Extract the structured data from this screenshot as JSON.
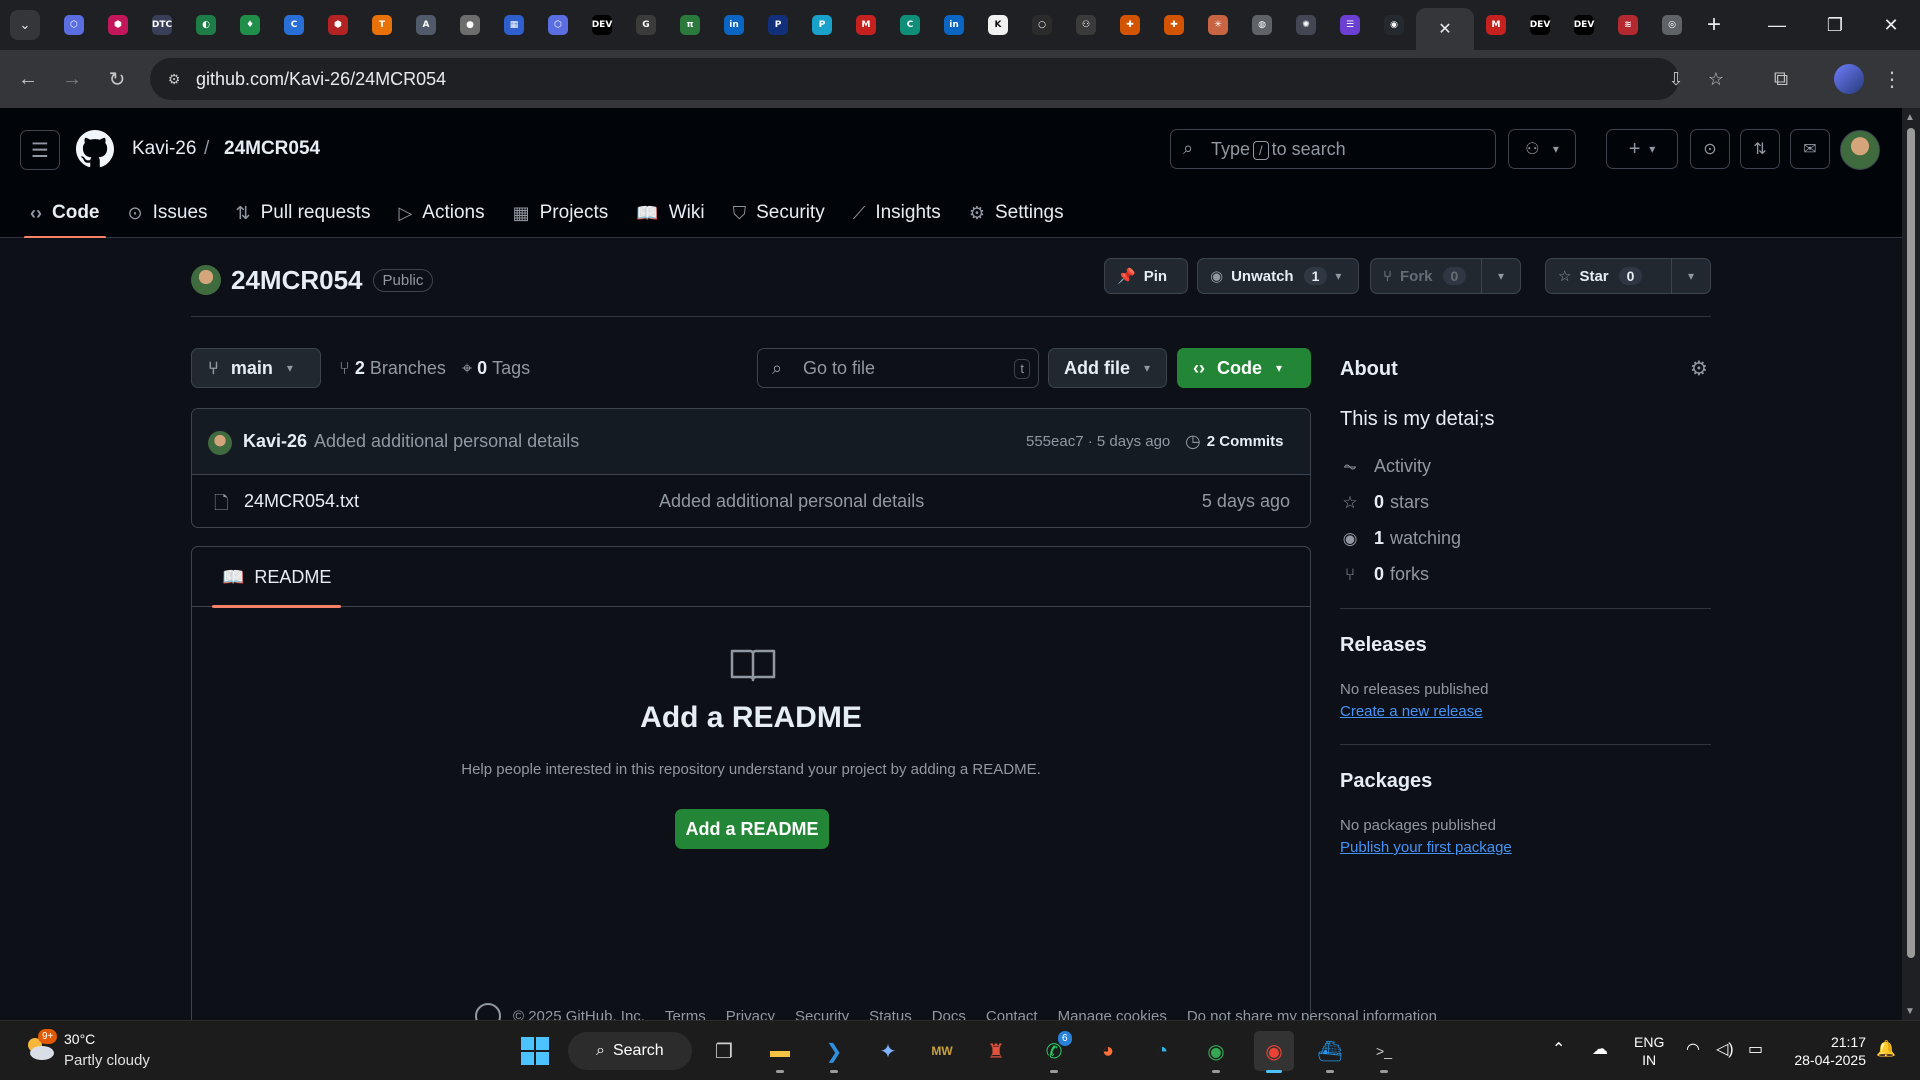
{
  "browser": {
    "tab_favicons": [
      {
        "name": "hexagon-tab-icon",
        "color": "#5b6ee1",
        "glyph": "⬡"
      },
      {
        "name": "shield-tab-icon",
        "color": "#c2185b",
        "glyph": "⬢"
      },
      {
        "name": "dtc-tab-icon",
        "color": "#3a3f58",
        "glyph": "DTC"
      },
      {
        "name": "green-circle-tab-icon",
        "color": "#1e7d46",
        "glyph": "◐"
      },
      {
        "name": "leaf-tab-icon",
        "color": "#1f8f4a",
        "glyph": "♦"
      },
      {
        "name": "c-tab-icon",
        "color": "#2a6fd6",
        "glyph": "C"
      },
      {
        "name": "red-badge-tab-icon",
        "color": "#b42323",
        "glyph": "⬢"
      },
      {
        "name": "tensorflow-tab-icon",
        "color": "#e8710a",
        "glyph": "T"
      },
      {
        "name": "a-tab-icon",
        "color": "#505a6b",
        "glyph": "A"
      },
      {
        "name": "profile-tab-icon",
        "color": "#6d6d6d",
        "glyph": "●"
      },
      {
        "name": "puzzle-tab-icon",
        "color": "#2f5fcc",
        "glyph": "▦"
      },
      {
        "name": "cube-tab-icon",
        "color": "#5b6ee1",
        "glyph": "⬡"
      },
      {
        "name": "dev-tab-icon",
        "color": "#000000",
        "glyph": "DEV"
      },
      {
        "name": "g-tab-icon",
        "color": "#3b3b3b",
        "glyph": "G"
      },
      {
        "name": "pi-tab-icon",
        "color": "#2b7a3b",
        "glyph": "π"
      },
      {
        "name": "linkedin-tab-icon",
        "color": "#0a66c2",
        "glyph": "in"
      },
      {
        "name": "paypal-tab-icon",
        "color": "#12307a",
        "glyph": "P"
      },
      {
        "name": "p-tab-icon",
        "color": "#1aa1c9",
        "glyph": "P"
      },
      {
        "name": "gmail-tab-icon",
        "color": "#c5221f",
        "glyph": "M"
      },
      {
        "name": "codechef-tab-icon",
        "color": "#0f8f7a",
        "glyph": "C"
      },
      {
        "name": "linkedin2-tab-icon",
        "color": "#0a66c2",
        "glyph": "in"
      },
      {
        "name": "k-tab-icon",
        "color": "#f1f1f1",
        "glyph": "K"
      },
      {
        "name": "github-dim-tab-icon",
        "color": "#2b2b2b",
        "glyph": "○"
      },
      {
        "name": "copilot-tab-icon",
        "color": "#3a3a3a",
        "glyph": "⚇"
      },
      {
        "name": "orange-tab-icon",
        "color": "#d35400",
        "glyph": "✚"
      },
      {
        "name": "orange2-tab-icon",
        "color": "#d35400",
        "glyph": "✚"
      },
      {
        "name": "claude-tab-icon",
        "color": "#c96442",
        "glyph": "✳"
      },
      {
        "name": "globe-tab-icon",
        "color": "#5f6368",
        "glyph": "◍"
      },
      {
        "name": "chatgpt-tab-icon",
        "color": "#444654",
        "glyph": "✺"
      },
      {
        "name": "purple-tab-icon",
        "color": "#6b3fd1",
        "glyph": "☰"
      },
      {
        "name": "github-tab-icon",
        "color": "#24292f",
        "glyph": "◉"
      }
    ],
    "tab_favicons_after": [
      {
        "name": "gmail2-tab-icon",
        "color": "#c5221f",
        "glyph": "M"
      },
      {
        "name": "dev2-tab-icon",
        "color": "#000000",
        "glyph": "DEV"
      },
      {
        "name": "dev3-tab-icon",
        "color": "#000000",
        "glyph": "DEV"
      },
      {
        "name": "stack-tab-icon",
        "color": "#b4282f",
        "glyph": "≋"
      },
      {
        "name": "chrome-tab-icon",
        "color": "#5f6368",
        "glyph": "◎"
      }
    ],
    "url": "github.com/Kavi-26/24MCR054"
  },
  "header": {
    "owner": "Kavi-26",
    "separator": "/",
    "repo": "24MCR054",
    "search_prefix": "Type",
    "search_key": "/",
    "search_suffix": "to search"
  },
  "repo_nav": [
    {
      "label": "Code",
      "icon": "‹›",
      "name": "tab-code"
    },
    {
      "label": "Issues",
      "icon": "⊙",
      "name": "tab-issues"
    },
    {
      "label": "Pull requests",
      "icon": "⇅",
      "name": "tab-pull-requests"
    },
    {
      "label": "Actions",
      "icon": "▷",
      "name": "tab-actions"
    },
    {
      "label": "Projects",
      "icon": "▦",
      "name": "tab-projects"
    },
    {
      "label": "Wiki",
      "icon": "📖",
      "name": "tab-wiki"
    },
    {
      "label": "Security",
      "icon": "⛉",
      "name": "tab-security"
    },
    {
      "label": "Insights",
      "icon": "⟋",
      "name": "tab-insights"
    },
    {
      "label": "Settings",
      "icon": "⚙",
      "name": "tab-settings"
    }
  ],
  "repo": {
    "name": "24MCR054",
    "visibility": "Public",
    "pin_label": "Pin",
    "watch_label": "Unwatch",
    "watch_count": "1",
    "fork_label": "Fork",
    "fork_count": "0",
    "star_label": "Star",
    "star_count": "0"
  },
  "branch_bar": {
    "branch": "main",
    "branches_count": "2",
    "branches_label": "Branches",
    "tags_count": "0",
    "tags_label": "Tags",
    "goto_placeholder": "Go to file",
    "goto_key": "t",
    "add_file_label": "Add file",
    "code_label": "Code"
  },
  "latest_commit": {
    "author": "Kavi-26",
    "message": "Added additional personal details",
    "hash_and_age": "555eac7 · 5 days ago",
    "commits_count": "2",
    "commits_label": "Commits"
  },
  "files": [
    {
      "name": "24MCR054.txt",
      "message": "Added additional personal details",
      "age": "5 days ago"
    }
  ],
  "readme": {
    "tab_label": "README",
    "title": "Add a README",
    "subtitle": "Help people interested in this repository understand your project by adding a README.",
    "button_label": "Add a README"
  },
  "about": {
    "heading": "About",
    "description": "This is my detai;s",
    "activity_label": "Activity",
    "stars_count": "0",
    "stars_label": "stars",
    "watching_count": "1",
    "watching_label": "watching",
    "forks_count": "0",
    "forks_label": "forks"
  },
  "releases": {
    "heading": "Releases",
    "empty_text": "No releases published",
    "link_label": "Create a new release"
  },
  "packages": {
    "heading": "Packages",
    "empty_text": "No packages published",
    "link_label": "Publish your first package"
  },
  "footer": {
    "copyright": "© 2025 GitHub, Inc.",
    "links": [
      "Terms",
      "Privacy",
      "Security",
      "Status",
      "Docs",
      "Contact",
      "Manage cookies",
      "Do not share my personal information"
    ]
  },
  "taskbar": {
    "weather_badge": "9+",
    "temperature": "30°C",
    "condition": "Partly cloudy",
    "search_label": "Search",
    "whatsapp_badge": "6",
    "lang_line1": "ENG",
    "lang_line2": "IN",
    "time": "21:17",
    "date": "28-04-2025"
  }
}
